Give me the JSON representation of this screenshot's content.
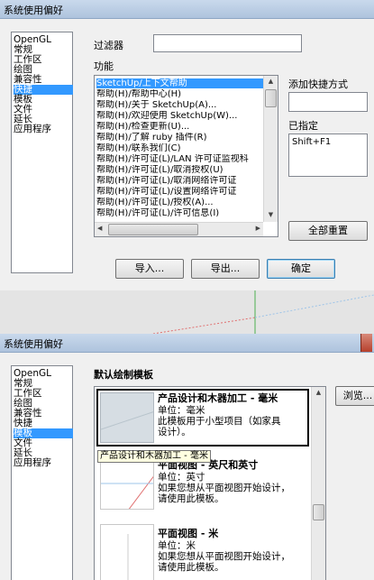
{
  "top_dialog": {
    "title": "系统使用偏好",
    "nav_items": [
      "OpenGL",
      "常规",
      "工作区",
      "绘图",
      "兼容性",
      "快捷",
      "模板",
      "文件",
      "延长",
      "应用程序"
    ],
    "nav_selected_index": 5,
    "filter_label": "过滤器",
    "filter_value": "",
    "function_label": "功能",
    "function_items": [
      "SketchUp/上下文帮助",
      "帮助(H)/帮助中心(H)",
      "帮助(H)/关于 SketchUp(A)...",
      "帮助(H)/欢迎使用 SketchUp(W)...",
      "帮助(H)/检查更新(U)...",
      "帮助(H)/了解 ruby 插件(R)",
      "帮助(H)/联系我们(C)",
      "帮助(H)/许可证(L)/LAN 许可证监视科",
      "帮助(H)/许可证(L)/取消授权(U)",
      "帮助(H)/许可证(L)/取消网络许可证",
      "帮助(H)/许可证(L)/设置网络许可证",
      "帮助(H)/许可证(L)/授权(A)...",
      "帮助(H)/许可证(L)/许可信息(I)"
    ],
    "function_selected_index": 0,
    "add_shortcut_label": "添加快捷方式",
    "add_shortcut_value": "",
    "assigned_label": "已指定",
    "assigned_value": "Shift+F1",
    "reset_all_button": "全部重置",
    "import_button": "导入...",
    "export_button": "导出...",
    "ok_button": "确定"
  },
  "bottom_dialog": {
    "title": "系统使用偏好",
    "nav_items": [
      "OpenGL",
      "常规",
      "工作区",
      "绘图",
      "兼容性",
      "快捷",
      "模板",
      "文件",
      "延长",
      "应用程序"
    ],
    "nav_selected_index": 6,
    "section_title": "默认绘制模板",
    "browse_button": "浏览...",
    "templates": [
      {
        "name": "产品设计和木器加工 - 毫米",
        "unit": "单位：毫米",
        "desc1": "此模板用于小型项目（如家具",
        "desc2": "设计）。",
        "selected": true
      },
      {
        "name": "平面视图 - 英尺和英寸",
        "unit": "单位：英寸",
        "desc1": "如果您想从平面视图开始设计，",
        "desc2": "请使用此模板。",
        "selected": false
      },
      {
        "name": "平面视图 - 米",
        "unit": "单位：米",
        "desc1": "如果您想从平面视图开始设计，",
        "desc2": "请使用此模板。",
        "selected": false
      }
    ],
    "tooltip": "产品设计和木器加工 - 毫米"
  },
  "colors": {
    "selection": "#3399ff",
    "title_bar": "#c0d3ea",
    "tooltip_bg": "#ffffe1"
  }
}
